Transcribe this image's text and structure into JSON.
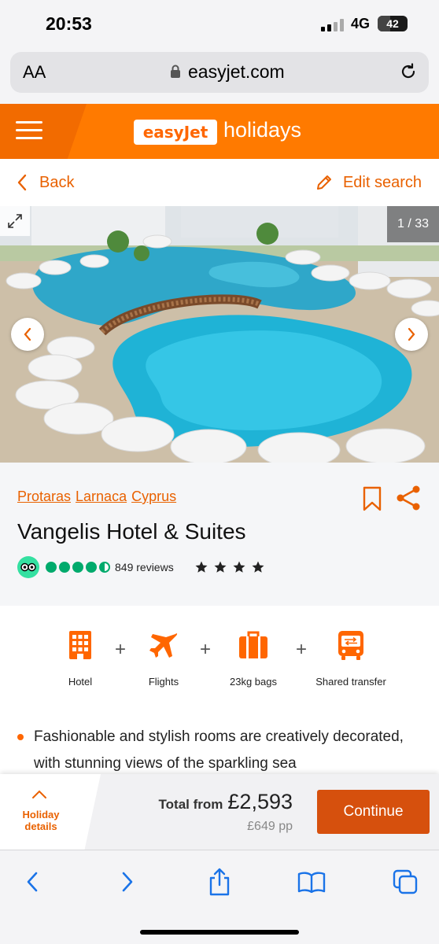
{
  "status_bar": {
    "time": "20:53",
    "network": "4G",
    "battery": "42",
    "battery_level": 0.42
  },
  "browser": {
    "text_size_label": "AA",
    "url": "easyjet.com"
  },
  "header": {
    "logo_text": "easyJet",
    "logo_suffix": "holidays"
  },
  "nav": {
    "back_label": "Back",
    "edit_label": "Edit search"
  },
  "gallery": {
    "counter": "1 / 33"
  },
  "hotel": {
    "location": [
      "Protaras",
      "Larnaca",
      "Cyprus"
    ],
    "name": "Vangelis Hotel & Suites",
    "tripadvisor_rating": 4.5,
    "reviews": "849 reviews",
    "stars": 4
  },
  "includes": [
    {
      "label": "Hotel",
      "icon": "hotel-building-icon"
    },
    {
      "label": "Flights",
      "icon": "plane-icon"
    },
    {
      "label": "23kg bags",
      "icon": "luggage-icon"
    },
    {
      "label": "Shared transfer",
      "icon": "bus-transfer-icon"
    }
  ],
  "description": {
    "bullet_text": "Fashionable and stylish rooms are creatively decorated, with stunning views of the sparkling sea"
  },
  "booking": {
    "details_label": "Holiday details",
    "total_label": "Total from",
    "total_price": "£2,593",
    "per_person": "£649 pp",
    "continue_label": "Continue"
  },
  "colors": {
    "brand_orange": "#ff6600",
    "link_orange": "#e96100",
    "continue_button": "#d6500d"
  }
}
